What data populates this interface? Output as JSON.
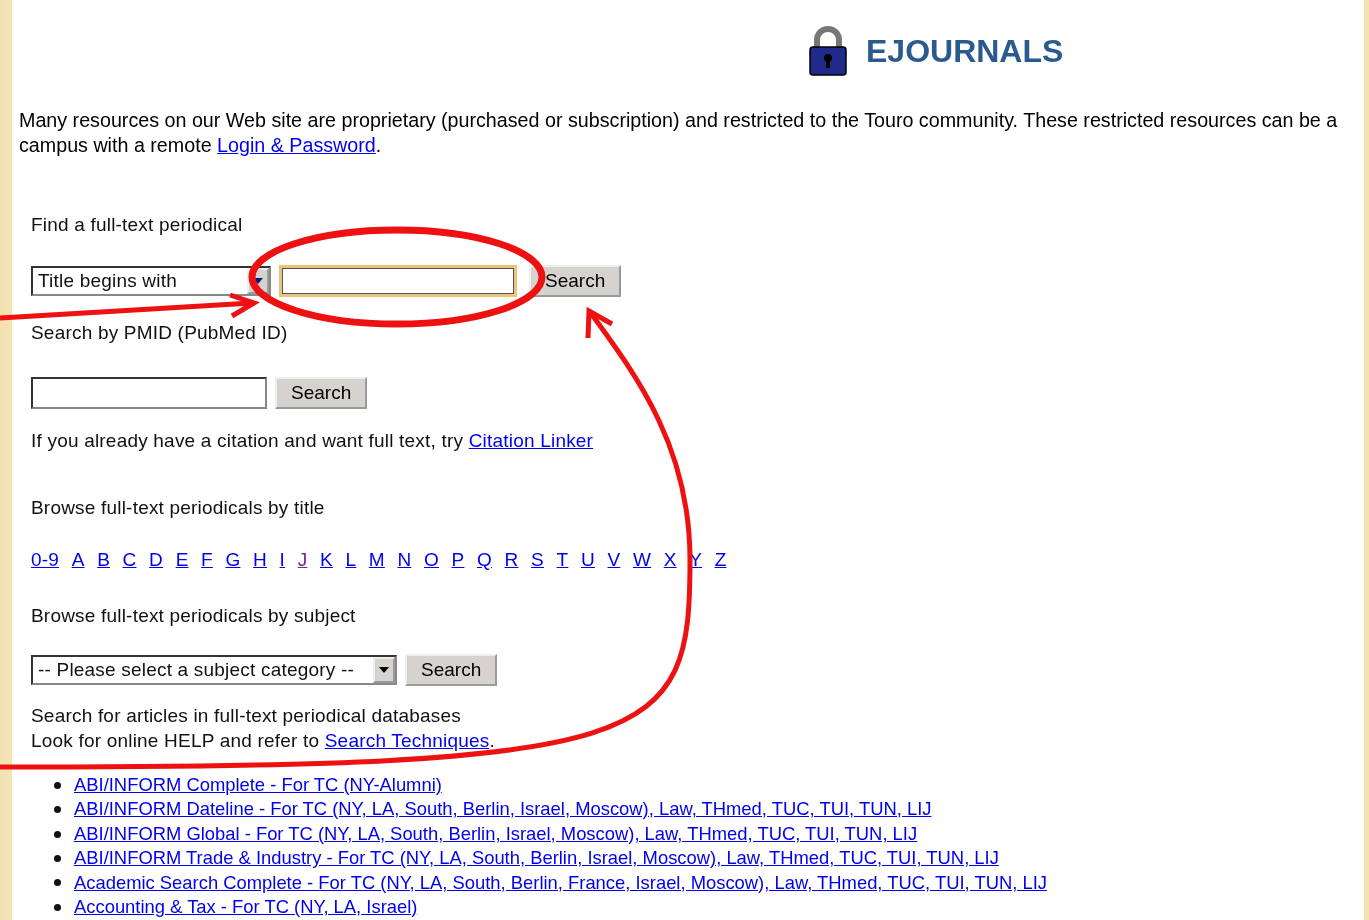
{
  "header": {
    "title": "EJOURNALS"
  },
  "intro": {
    "line_1": "Many resources on our Web site are proprietary (purchased or subscription) and restricted to the Touro community. These restricted resources can be a",
    "line_2_text": "campus with a remote ",
    "line_2_link": "Login & Password",
    "line_2_end": "."
  },
  "title_search": {
    "label": "Find a full-text periodical",
    "mode": "Title begins with",
    "focused": true,
    "button": "Search"
  },
  "pmid_search": {
    "label": "Search by PMID (PubMed ID)",
    "focused": false,
    "button": "Search"
  },
  "citation": {
    "text": "If you already have a citation and want full text, try ",
    "link": "Citation Linker"
  },
  "browse_title": {
    "label": "Browse full-text periodicals by title",
    "letters": [
      {
        "label": "0-9",
        "visited": false
      },
      {
        "label": "A",
        "visited": false
      },
      {
        "label": "B",
        "visited": false
      },
      {
        "label": "C",
        "visited": false
      },
      {
        "label": "D",
        "visited": false
      },
      {
        "label": "E",
        "visited": false
      },
      {
        "label": "F",
        "visited": false
      },
      {
        "label": "G",
        "visited": false
      },
      {
        "label": "H",
        "visited": false
      },
      {
        "label": "I",
        "visited": false
      },
      {
        "label": "J",
        "visited": true
      },
      {
        "label": "K",
        "visited": false
      },
      {
        "label": "L",
        "visited": false
      },
      {
        "label": "M",
        "visited": false
      },
      {
        "label": "N",
        "visited": false
      },
      {
        "label": "O",
        "visited": false
      },
      {
        "label": "P",
        "visited": false
      },
      {
        "label": "Q",
        "visited": false
      },
      {
        "label": "R",
        "visited": false
      },
      {
        "label": "S",
        "visited": false
      },
      {
        "label": "T",
        "visited": false
      },
      {
        "label": "U",
        "visited": false
      },
      {
        "label": "V",
        "visited": false
      },
      {
        "label": "W",
        "visited": false
      },
      {
        "label": "X",
        "visited": false
      },
      {
        "label": "Y",
        "visited": false
      },
      {
        "label": "Z",
        "visited": false
      }
    ]
  },
  "browse_subject": {
    "label": "Browse full-text periodicals by subject",
    "select": "-- Please select a subject category --",
    "button": "Search"
  },
  "databases": {
    "line_1": "Search for articles in full-text periodical databases",
    "line_2_text": "Look for online HELP and refer to ",
    "line_2_link": "Search Techniques",
    "line_2_end": ".",
    "items": [
      "ABI/INFORM Complete - For TC (NY-Alumni)",
      "ABI/INFORM Dateline - For TC (NY, LA, South, Berlin, Israel, Moscow), Law, THmed, TUC, TUI, TUN, LIJ",
      "ABI/INFORM Global - For TC (NY, LA, South, Berlin, Israel, Moscow), Law, THmed, TUC, TUI, TUN, LIJ",
      "ABI/INFORM Trade & Industry - For TC (NY, LA, South, Berlin, Israel, Moscow), Law, THmed, TUC, TUI, TUN, LIJ",
      "Academic Search Complete - For TC (NY, LA, South, Berlin, France, Israel, Moscow), Law, THmed, TUC, TUI, TUN, LIJ",
      "Accounting & Tax - For TC (NY, LA, Israel)"
    ]
  }
}
